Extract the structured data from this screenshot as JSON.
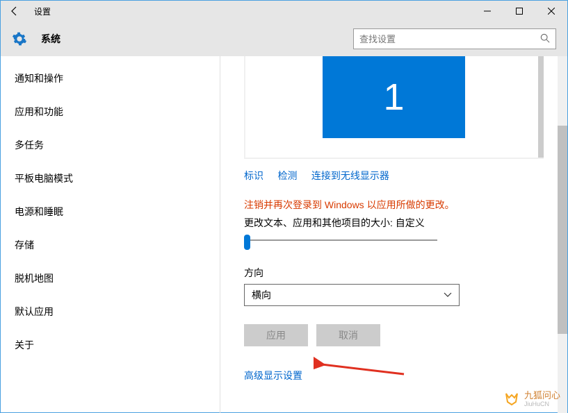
{
  "titlebar": {
    "title": "设置"
  },
  "header": {
    "section": "系统",
    "search_placeholder": "查找设置"
  },
  "sidebar": {
    "items": [
      {
        "label": "通知和操作"
      },
      {
        "label": "应用和功能"
      },
      {
        "label": "多任务"
      },
      {
        "label": "平板电脑模式"
      },
      {
        "label": "电源和睡眠"
      },
      {
        "label": "存储"
      },
      {
        "label": "脱机地图"
      },
      {
        "label": "默认应用"
      },
      {
        "label": "关于"
      }
    ]
  },
  "main": {
    "monitor_number": "1",
    "links": {
      "identify": "标识",
      "detect": "检测",
      "wireless": "连接到无线显示器"
    },
    "warning": "注销并再次登录到 Windows 以应用所做的更改。",
    "scale_label": "更改文本、应用和其他项目的大小: 自定义",
    "orientation_label": "方向",
    "orientation_value": "横向",
    "apply": "应用",
    "cancel": "取消",
    "advanced": "高级显示设置"
  },
  "watermark": {
    "cn": "九狐问心",
    "en": "JiuHuCN"
  }
}
